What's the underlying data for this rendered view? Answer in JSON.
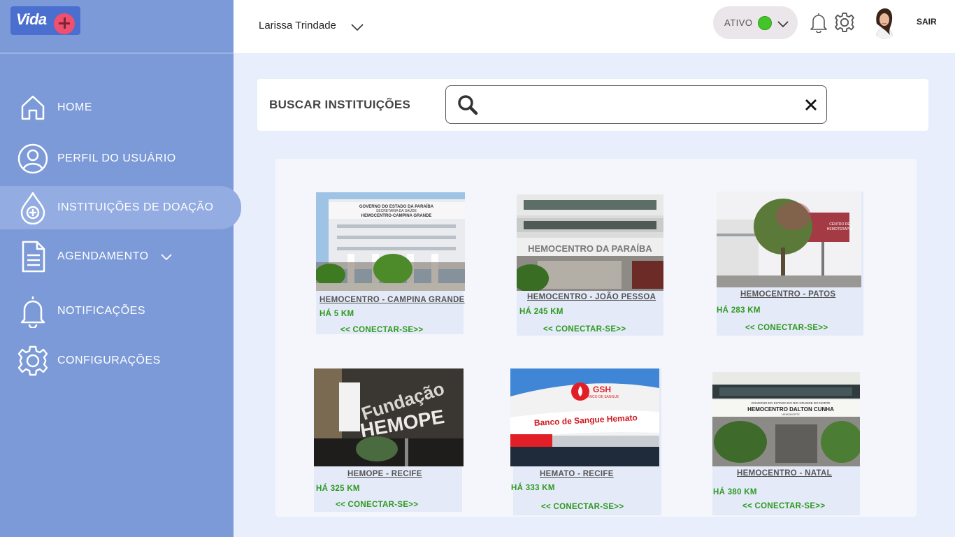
{
  "app": {
    "logo_text": "Vida",
    "brand_color": "#4a6fcf"
  },
  "sidebar": {
    "items": [
      {
        "label": "HOME",
        "icon": "home-icon"
      },
      {
        "label": "PERFIL DO USUÁRIO",
        "icon": "user-icon"
      },
      {
        "label": "INSTITUIÇÕES DE DOAÇÃO",
        "icon": "blood-drop-plus-icon",
        "active": true
      },
      {
        "label": "AGENDAMENTO",
        "icon": "document-icon"
      },
      {
        "label": "NOTIFICAÇÕES",
        "icon": "bell-icon"
      },
      {
        "label": "CONFIGURAÇÕES",
        "icon": "gear-icon"
      }
    ]
  },
  "header": {
    "user_name": "Larissa Trindade",
    "status_label": "ATIVO",
    "status_color": "#43c52a",
    "logout_label": "SAIR"
  },
  "search": {
    "title": "BUSCAR INSTITUIÇÕES",
    "value": "",
    "placeholder": ""
  },
  "institutions": [
    {
      "name": "HEMOCENTRO - CAMPINA GRANDE",
      "distance": "HÁ 5 KM",
      "action": "<< CONECTAR-SE>>",
      "photo_sign": "GOVERNO DO ESTADO DA PARAÍBA\nSECRETARIA DA SAÚDE\nHEMOCENTRO-CAMPINA GRANDE"
    },
    {
      "name": "HEMOCENTRO - JOÃO PESSOA",
      "distance": "HÁ 245 KM",
      "action": "<< CONECTAR-SE>>",
      "photo_sign": "HEMOCENTRO DA PARAÍBA"
    },
    {
      "name": "HEMOCENTRO - PATOS",
      "distance": "HÁ 283 KM",
      "action": "<< CONECTAR-SE>>",
      "photo_sign": "CENTRO DE HEMOTERAPIA"
    },
    {
      "name": "HEMOPE - RECIFE",
      "distance": "HÁ 325 KM",
      "action": "<< CONECTAR-SE>>",
      "photo_sign": "Fundação HEMOPE"
    },
    {
      "name": "HEMATO - RECIFE",
      "distance": "HÁ 333 KM",
      "action": "<< CONECTAR-SE>>",
      "photo_sign": "Banco de Sangue Hemato",
      "photo_logo": "GSH BANCO DE SANGUE"
    },
    {
      "name": "HEMOCENTRO - NATAL",
      "distance": "HÁ 380 KM",
      "action": "<< CONECTAR-SE>>",
      "photo_sign": "HEMOCENTRO DALTON CUNHA",
      "photo_sub": "GOVERNO DO ESTADO DO RIO GRANDE DO NORTE"
    }
  ]
}
